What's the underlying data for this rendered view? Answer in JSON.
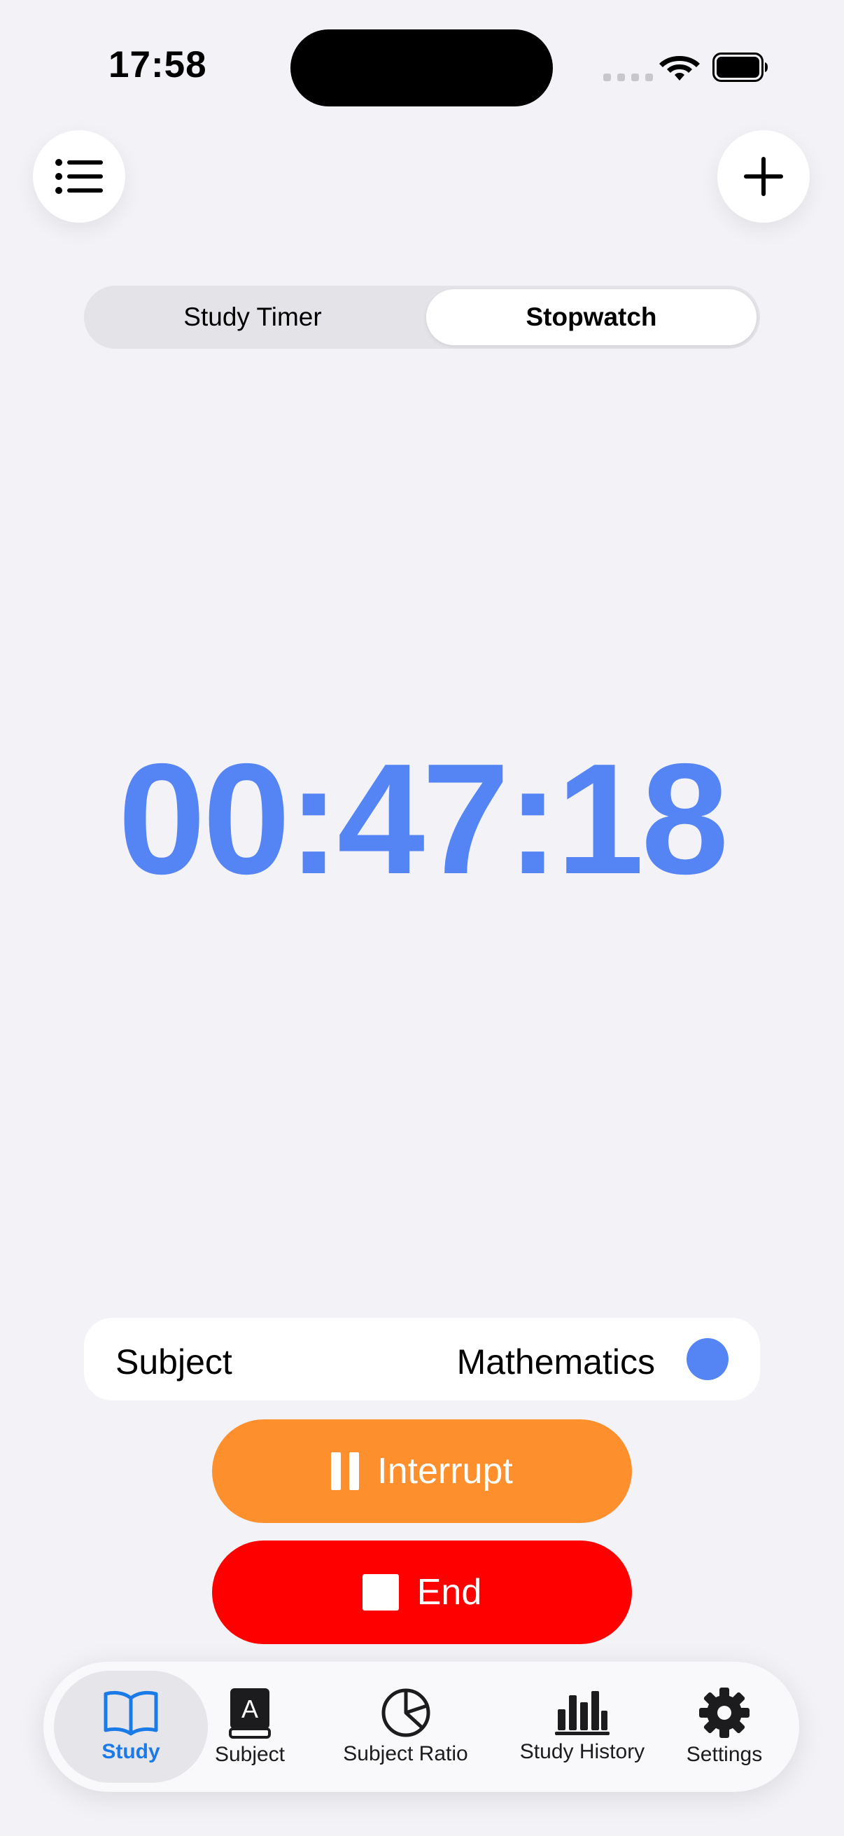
{
  "status_bar": {
    "time": "17:58"
  },
  "mode_selector": {
    "options": [
      "Study Timer",
      "Stopwatch"
    ],
    "selected": "Stopwatch"
  },
  "timer": {
    "display": "00:47:18",
    "color": "#5584f5"
  },
  "subject": {
    "label": "Subject",
    "value": "Mathematics",
    "color": "#5584f5"
  },
  "actions": {
    "interrupt_label": "Interrupt",
    "end_label": "End",
    "interrupt_color": "#fd8f2c",
    "end_color": "#ff0000"
  },
  "tab_bar": {
    "items": [
      {
        "label": "Study",
        "icon": "book-icon",
        "active": true
      },
      {
        "label": "Subject",
        "icon": "subject-book-icon",
        "active": false
      },
      {
        "label": "Subject Ratio",
        "icon": "pie-chart-icon",
        "active": false
      },
      {
        "label": "Study History",
        "icon": "bar-chart-icon",
        "active": false
      },
      {
        "label": "Settings",
        "icon": "gear-icon",
        "active": false
      }
    ],
    "accent": "#1a7ae8"
  }
}
